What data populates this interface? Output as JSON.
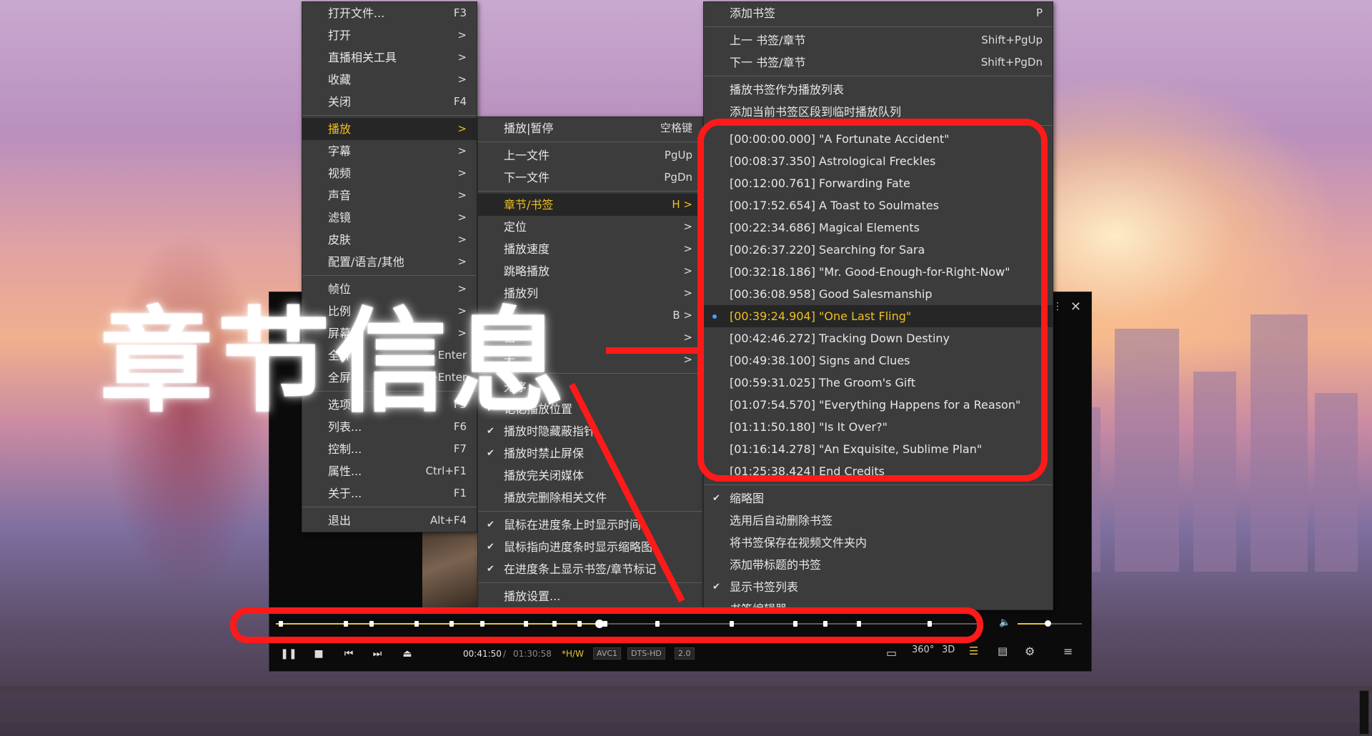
{
  "overlay": {
    "title": "章节信息"
  },
  "main_menu": [
    {
      "label": "打开文件...",
      "shortcut": "F3"
    },
    {
      "label": "打开",
      "shortcut": ">"
    },
    {
      "label": "直播相关工具",
      "shortcut": ">"
    },
    {
      "label": "收藏",
      "shortcut": ">"
    },
    {
      "label": "关闭",
      "shortcut": "F4"
    },
    {
      "label": "播放",
      "shortcut": ">",
      "active": true
    },
    {
      "label": "字幕",
      "shortcut": ">"
    },
    {
      "label": "视频",
      "shortcut": ">"
    },
    {
      "label": "声音",
      "shortcut": ">"
    },
    {
      "label": "滤镜",
      "shortcut": ">"
    },
    {
      "label": "皮肤",
      "shortcut": ">"
    },
    {
      "label": "配置/语言/其他",
      "shortcut": ">"
    },
    {
      "label": "帧位",
      "shortcut": ">"
    },
    {
      "label": "比例",
      "shortcut": ">"
    },
    {
      "label": "屏幕",
      "shortcut": ">"
    },
    {
      "label": "全屏",
      "shortcut": "Enter"
    },
    {
      "label": "全屏+",
      "shortcut": "Ctrl+Enter"
    },
    {
      "label": "选项...",
      "shortcut": "F5"
    },
    {
      "label": "列表...",
      "shortcut": "F6"
    },
    {
      "label": "控制...",
      "shortcut": "F7"
    },
    {
      "label": "属性...",
      "shortcut": "Ctrl+F1"
    },
    {
      "label": "关于...",
      "shortcut": "F1"
    },
    {
      "label": "退出",
      "shortcut": "Alt+F4"
    }
  ],
  "play_menu": [
    {
      "label": "播放|暂停",
      "shortcut": "空格键"
    },
    {
      "label": "上一文件",
      "shortcut": "PgUp"
    },
    {
      "label": "下一文件",
      "shortcut": "PgDn"
    },
    {
      "label": "章节/书签",
      "shortcut": "H >",
      "active": true
    },
    {
      "label": "定位",
      "shortcut": ">"
    },
    {
      "label": "播放速度",
      "shortcut": ">"
    },
    {
      "label": "跳略播放",
      "shortcut": ">"
    },
    {
      "label": "播放列",
      "shortcut": ">"
    },
    {
      "label": "A",
      "shortcut": "B >"
    },
    {
      "label": "循",
      "shortcut": ">"
    },
    {
      "label": "无",
      "shortcut": ">"
    },
    {
      "label": "无序",
      "shortcut": ""
    },
    {
      "label": "记忆播放位置",
      "shortcut": "",
      "checked": true
    },
    {
      "label": "播放时隐藏蔽指针",
      "shortcut": "",
      "checked": true
    },
    {
      "label": "播放时禁止屏保",
      "shortcut": "",
      "checked": true
    },
    {
      "label": "播放完关闭媒体",
      "shortcut": ""
    },
    {
      "label": "播放完删除相关文件",
      "shortcut": ""
    },
    {
      "label": "鼠标在进度条上时显示时间",
      "shortcut": "",
      "checked": true
    },
    {
      "label": "鼠标指向进度条时显示缩略图",
      "shortcut": "",
      "checked": true
    },
    {
      "label": "在进度条上显示书签/章节标记",
      "shortcut": "",
      "checked": true
    },
    {
      "label": "播放设置...",
      "shortcut": ""
    }
  ],
  "chapter_menu": {
    "top": [
      {
        "label": "添加书签",
        "shortcut": "P"
      },
      {
        "label": "上一 书签/章节",
        "shortcut": "Shift+PgUp"
      },
      {
        "label": "下一 书签/章节",
        "shortcut": "Shift+PgDn"
      },
      {
        "label": "播放书签作为播放列表",
        "shortcut": ""
      },
      {
        "label": "添加当前书签区段到临时播放队列",
        "shortcut": ""
      }
    ],
    "chapters": [
      "[00:00:00.000] \"A Fortunate Accident\"",
      "[00:08:37.350] Astrological Freckles",
      "[00:12:00.761] Forwarding Fate",
      "[00:17:52.654] A Toast to Soulmates",
      "[00:22:34.686] Magical Elements",
      "[00:26:37.220] Searching for Sara",
      "[00:32:18.186] \"Mr. Good-Enough-for-Right-Now\"",
      "[00:36:08.958] Good Salesmanship",
      "[00:39:24.904] \"One Last Fling\"",
      "[00:42:46.272] Tracking Down Destiny",
      "[00:49:38.100] Signs and Clues",
      "[00:59:31.025] The Groom's Gift",
      "[01:07:54.570] \"Everything Happens for a Reason\"",
      "[01:11:50.180] \"Is It Over?\"",
      "[01:16:14.278] \"An Exquisite, Sublime Plan\"",
      "[01:25:38.424] End Credits"
    ],
    "current_chapter_index": 8,
    "bottom": [
      {
        "label": "缩略图",
        "checked": true
      },
      {
        "label": "选用后自动删除书签",
        "checked": false
      },
      {
        "label": "将书签保存在视频文件夹内",
        "checked": false
      },
      {
        "label": "添加带标题的书签",
        "checked": false
      },
      {
        "label": "显示书签列表",
        "checked": true
      },
      {
        "label": "书签编辑器",
        "checked": false
      }
    ]
  },
  "player": {
    "time_current": "00:41:50",
    "time_separator": "/",
    "time_total": "01:30:58",
    "progress_fraction": 0.46,
    "badges": [
      "*H/W",
      "AVC1",
      "DTS-HD",
      "2.0"
    ],
    "right_buttons": [
      "360°",
      "3D"
    ],
    "volume_fraction": 0.47,
    "colors": {
      "accent": "#e5c43a",
      "highlight": "#ff1a1a",
      "active_text": "#f0c020"
    }
  }
}
